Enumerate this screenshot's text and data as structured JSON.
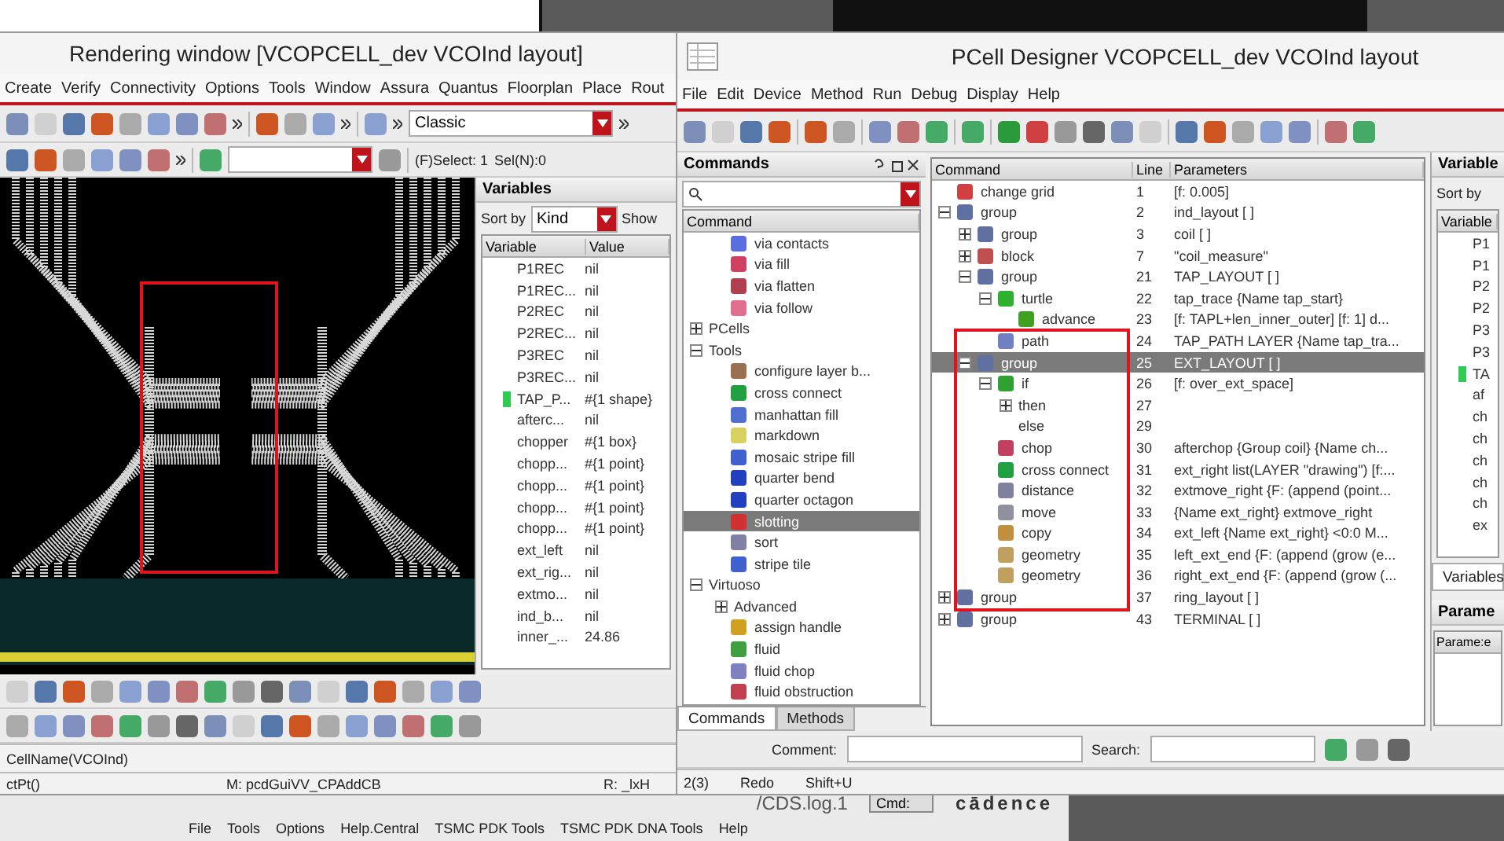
{
  "background_window": {
    "log_title": "/CDS.log.1",
    "logo": "cādence",
    "cmd_label": "Cmd:",
    "menu": [
      "File",
      "Tools",
      "Options",
      "Help.Central",
      "TSMC PDK Tools",
      "TSMC PDK DNA Tools",
      "Help"
    ]
  },
  "rendering_window": {
    "title": "Rendering window [VCOPCELL_dev VCOInd layout]",
    "menu": [
      "Create",
      "Verify",
      "Connectivity",
      "Options",
      "Tools",
      "Window",
      "Assura",
      "Quantus",
      "Floorplan",
      "Place",
      "Rout"
    ],
    "style_select": "Classic",
    "select_info": "(F)Select: 1",
    "sel_info": "Sel(N):0",
    "variables": {
      "title": "Variables",
      "sort_label": "Sort by",
      "sort_value": "Kind",
      "show_label": "Show",
      "columns": [
        "Variable",
        "Value"
      ],
      "rows": [
        {
          "name": "P1REC",
          "value": "nil",
          "marked": false
        },
        {
          "name": "P1REC...",
          "value": "nil",
          "marked": false
        },
        {
          "name": "P2REC",
          "value": "nil",
          "marked": false
        },
        {
          "name": "P2REC...",
          "value": "nil",
          "marked": false
        },
        {
          "name": "P3REC",
          "value": "nil",
          "marked": false
        },
        {
          "name": "P3REC...",
          "value": "nil",
          "marked": false
        },
        {
          "name": "TAP_P...",
          "value": "#{1 shape}",
          "marked": true
        },
        {
          "name": "afterc...",
          "value": "nil",
          "marked": false
        },
        {
          "name": "chopper",
          "value": "#{1 box}",
          "marked": false
        },
        {
          "name": "chopp...",
          "value": "#{1 point}",
          "marked": false
        },
        {
          "name": "chopp...",
          "value": "#{1 point}",
          "marked": false
        },
        {
          "name": "chopp...",
          "value": "#{1 point}",
          "marked": false
        },
        {
          "name": "chopp...",
          "value": "#{1 point}",
          "marked": false
        },
        {
          "name": "ext_left",
          "value": "nil",
          "marked": false
        },
        {
          "name": "ext_rig...",
          "value": "nil",
          "marked": false
        },
        {
          "name": "extmo...",
          "value": "nil",
          "marked": false
        },
        {
          "name": "ind_b...",
          "value": "nil",
          "marked": false
        },
        {
          "name": "inner_...",
          "value": "24.86",
          "marked": false
        }
      ]
    },
    "status": {
      "cell": "CellName(VCOInd)",
      "left": "ctPt()",
      "middle": "M: pcdGuiVV_CPAddCB",
      "right": "R: _lxH"
    }
  },
  "pcell_window": {
    "title": "PCell Designer VCOPCELL_dev VCOInd layout",
    "menu": [
      "File",
      "Edit",
      "Device",
      "Method",
      "Run",
      "Debug",
      "Display",
      "Help"
    ],
    "commands": {
      "title": "Commands",
      "column": "Command",
      "items": [
        {
          "label": "via contacts",
          "kind": "command",
          "selected": false,
          "color": "#5a6ee0"
        },
        {
          "label": "via fill",
          "kind": "command",
          "selected": false,
          "color": "#d04060"
        },
        {
          "label": "via flatten",
          "kind": "command",
          "selected": false,
          "color": "#b04050"
        },
        {
          "label": "via follow",
          "kind": "command",
          "selected": false,
          "color": "#e07090"
        },
        {
          "label": "PCells",
          "kind": "folder",
          "expanded": false,
          "selected": false
        },
        {
          "label": "Tools",
          "kind": "folder",
          "expanded": true,
          "selected": false,
          "children": [
            {
              "label": "configure layer b...",
              "kind": "command",
              "selected": false,
              "color": "#9a7050"
            },
            {
              "label": "cross connect",
              "kind": "command",
              "selected": false,
              "color": "#20a040"
            },
            {
              "label": "manhattan fill",
              "kind": "command",
              "selected": false,
              "color": "#5070d0"
            },
            {
              "label": "markdown",
              "kind": "command",
              "selected": false,
              "color": "#d8d060"
            },
            {
              "label": "mosaic stripe fill",
              "kind": "command",
              "selected": false,
              "color": "#4060d0"
            },
            {
              "label": "quarter bend",
              "kind": "command",
              "selected": false,
              "color": "#2040c0"
            },
            {
              "label": "quarter octagon",
              "kind": "command",
              "selected": false,
              "color": "#2040c0"
            },
            {
              "label": "slotting",
              "kind": "command",
              "selected": true,
              "color": "#d03030"
            },
            {
              "label": "sort",
              "kind": "command",
              "selected": false,
              "color": "#8080a0"
            },
            {
              "label": "stripe tile",
              "kind": "command",
              "selected": false,
              "color": "#4060d0"
            }
          ]
        },
        {
          "label": "Virtuoso",
          "kind": "folder",
          "expanded": true,
          "selected": false,
          "children": [
            {
              "label": "Advanced",
              "kind": "folder",
              "expanded": false,
              "selected": false
            },
            {
              "label": "assign handle",
              "kind": "command",
              "selected": false,
              "color": "#d0a020"
            },
            {
              "label": "fluid",
              "kind": "command",
              "selected": false,
              "color": "#40a040"
            },
            {
              "label": "fluid chop",
              "kind": "command",
              "selected": false,
              "color": "#8080c0"
            },
            {
              "label": "fluid obstruction",
              "kind": "command",
              "selected": false,
              "color": "#c04050"
            }
          ]
        }
      ],
      "tabs": [
        {
          "label": "Commands",
          "selected": true
        },
        {
          "label": "Methods",
          "selected": false
        }
      ]
    },
    "tree": {
      "columns": [
        "Command",
        "Line",
        "Parameters"
      ],
      "rows": [
        {
          "command": "change grid",
          "line": "1",
          "params": "[f: 0.005]",
          "selected": false,
          "color": "#d04040"
        },
        {
          "command": "group",
          "line": "2",
          "params": "ind_layout [ ]",
          "expanded": true,
          "selected": false,
          "color": "#6070a0",
          "children": [
            {
              "command": "group",
              "line": "3",
              "params": "coil [ ]",
              "expanded": false,
              "selected": false,
              "color": "#6070a0"
            },
            {
              "command": "block",
              "line": "7",
              "params": "\"coil_measure\"",
              "expanded": false,
              "selected": false,
              "color": "#c05050"
            },
            {
              "command": "group",
              "line": "21",
              "params": "TAP_LAYOUT [ ]",
              "expanded": true,
              "selected": false,
              "color": "#6070a0",
              "children": [
                {
                  "command": "turtle",
                  "line": "22",
                  "params": "tap_trace {Name tap_start}",
                  "expanded": true,
                  "selected": false,
                  "color": "#30b030",
                  "children": [
                    {
                      "command": "advance",
                      "line": "23",
                      "params": "[f: TAPL+len_inner_outer] [f: 1] d...",
                      "selected": false,
                      "color": "#40a020"
                    }
                  ]
                },
                {
                  "command": "path",
                  "line": "24",
                  "params": "TAP_PATH LAYER {Name tap_tra...",
                  "selected": false,
                  "color": "#7080c0"
                }
              ]
            },
            {
              "command": "group",
              "line": "25",
              "params": "EXT_LAYOUT [ ]",
              "expanded": true,
              "selected": true,
              "color": "#6070a0",
              "children": [
                {
                  "command": "if",
                  "line": "26",
                  "params": "[f: over_ext_space]",
                  "expanded": true,
                  "selected": false,
                  "color": "#30a030",
                  "children": [
                    {
                      "command": "then",
                      "line": "27",
                      "expanded": false,
                      "selected": false
                    },
                    {
                      "command": "else",
                      "line": "29",
                      "selected": false
                    }
                  ]
                },
                {
                  "command": "chop",
                  "line": "30",
                  "params": "afterchop {Group coil} {Name ch...",
                  "selected": false,
                  "color": "#c04060"
                },
                {
                  "command": "cross connect",
                  "line": "31",
                  "params": "ext_right list(LAYER \"drawing\") [f:...",
                  "selected": false,
                  "color": "#20a040"
                },
                {
                  "command": "distance",
                  "line": "32",
                  "params": "extmove_right {F: (append (point...",
                  "selected": false,
                  "color": "#8080a0"
                },
                {
                  "command": "move",
                  "line": "33",
                  "params": "{Name ext_right} extmove_right",
                  "selected": false,
                  "color": "#9090a0"
                },
                {
                  "command": "copy",
                  "line": "34",
                  "params": "ext_left {Name ext_right} <0:0 M...",
                  "selected": false,
                  "color": "#c09040"
                },
                {
                  "command": "geometry",
                  "line": "35",
                  "params": "left_ext_end {F: (append (grow (e...",
                  "selected": false,
                  "color": "#c0a060"
                },
                {
                  "command": "geometry",
                  "line": "36",
                  "params": "right_ext_end {F: (append (grow (...",
                  "selected": false,
                  "color": "#c0a060"
                }
              ]
            }
          ]
        },
        {
          "command": "group",
          "line": "37",
          "params": "ring_layout [ ]",
          "expanded": false,
          "selected": false,
          "color": "#6070a0"
        },
        {
          "command": "group",
          "line": "43",
          "params": "TERMINAL [ ]",
          "expanded": false,
          "selected": false,
          "color": "#6070a0"
        }
      ]
    },
    "side_variables": {
      "title": "Variable",
      "sort_label": "Sort by",
      "column": "Variable",
      "rows": [
        {
          "name": "P1",
          "marked": false
        },
        {
          "name": "P1",
          "marked": false
        },
        {
          "name": "P2",
          "marked": false
        },
        {
          "name": "P2",
          "marked": false
        },
        {
          "name": "P3",
          "marked": false
        },
        {
          "name": "P3",
          "marked": false
        },
        {
          "name": "TA",
          "marked": true
        },
        {
          "name": "af",
          "marked": false
        },
        {
          "name": "ch",
          "marked": false
        },
        {
          "name": "ch",
          "marked": false
        },
        {
          "name": "ch",
          "marked": false
        },
        {
          "name": "ch",
          "marked": false
        },
        {
          "name": "ch",
          "marked": false
        },
        {
          "name": "ex",
          "marked": false
        }
      ],
      "tab": "Variables",
      "params_title": "Parame",
      "params_column": "Parame:e"
    },
    "comment_label": "Comment:",
    "search_label": "Search:",
    "status": {
      "count": "2(3)",
      "action": "Redo",
      "shortcut": "Shift+U"
    }
  }
}
